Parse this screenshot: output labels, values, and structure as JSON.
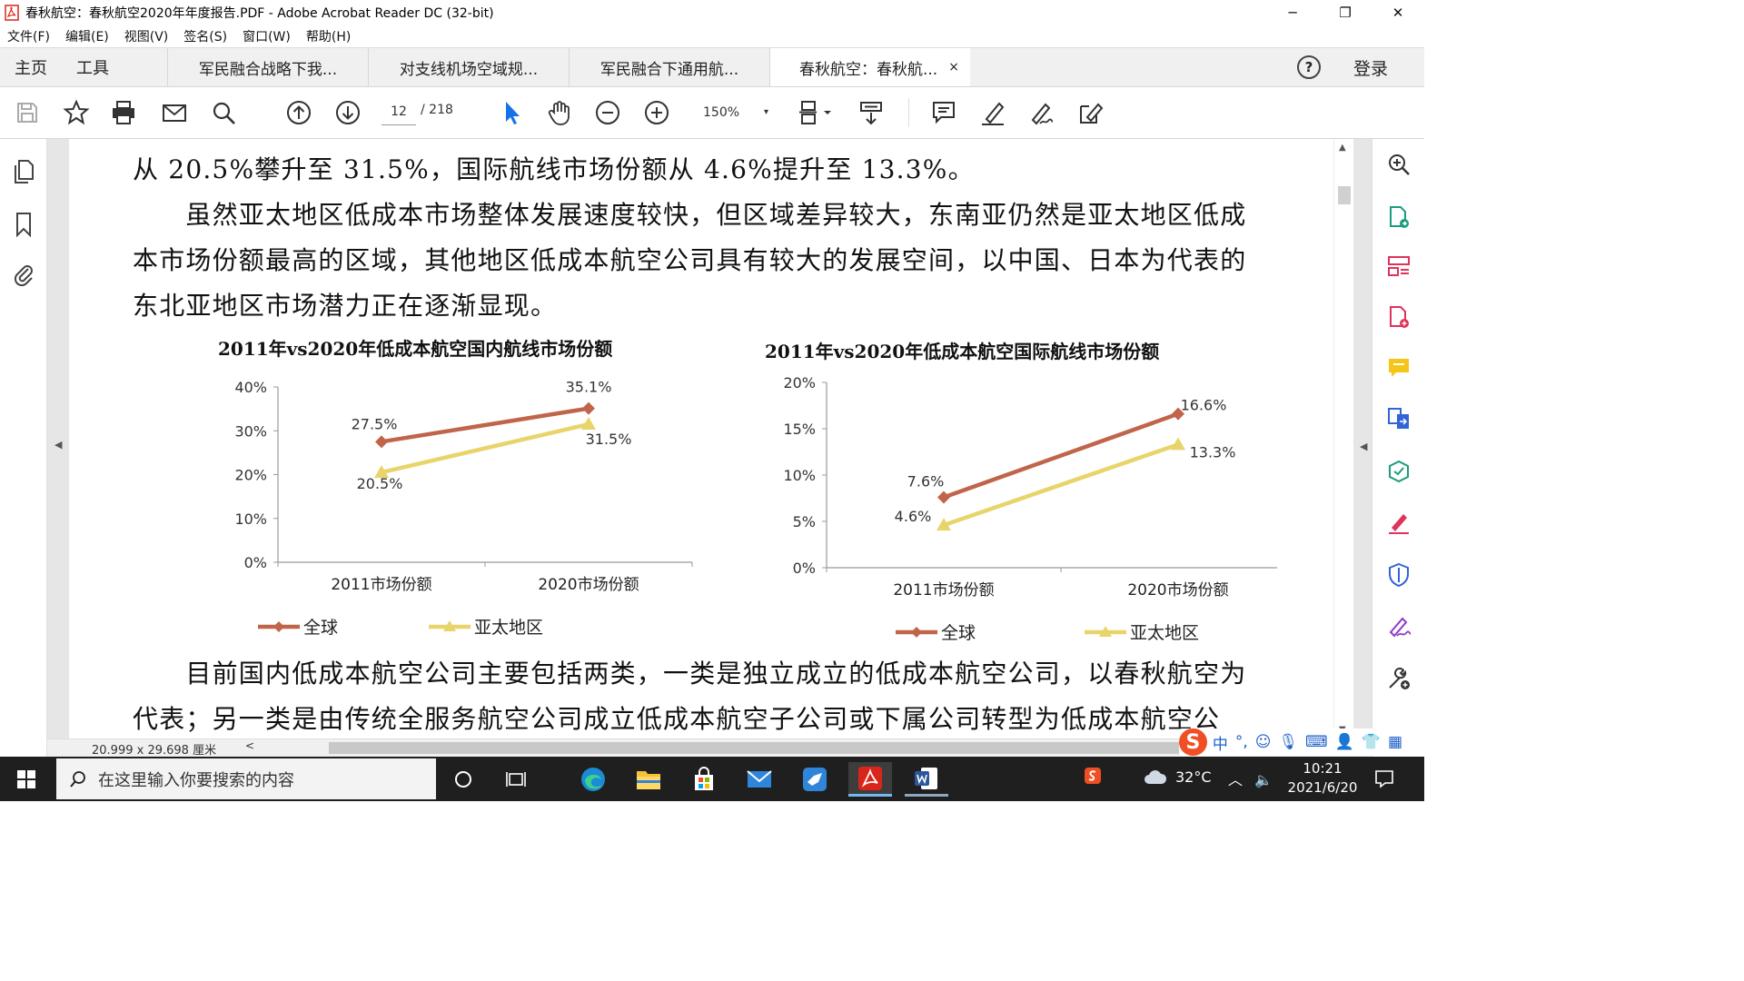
{
  "window": {
    "title": "春秋航空：春秋航空2020年年度报告.PDF - Adobe Acrobat Reader DC (32-bit)"
  },
  "menu": [
    "文件(F)",
    "编辑(E)",
    "视图(V)",
    "签名(S)",
    "窗口(W)",
    "帮助(H)"
  ],
  "tabs": {
    "home": "主页",
    "tools": "工具",
    "docs": [
      "军民融合战略下我...",
      "对支线机场空域规...",
      "军民融合下通用航...",
      "春秋航空：春秋航..."
    ],
    "close": "×",
    "login": "登录",
    "help": "?"
  },
  "toolbar": {
    "page_current": "12",
    "page_total": "/ 218",
    "zoom": "150%",
    "zoom_arrow": "▾"
  },
  "document": {
    "paragraphs": [
      "从 20.5%攀升至 31.5%，国际航线市场份额从 4.6%提升至 13.3%。",
      "　　虽然亚太地区低成本市场整体发展速度较快，但区域差异较大，东南亚仍然是亚太地区低成",
      "本市场份额最高的区域，其他地区低成本航空公司具有较大的发展空间，以中国、日本为代表的",
      "东北亚地区市场潜力正在逐渐显现。",
      "　　目前国内低成本航空公司主要包括两类，一类是独立成立的低成本航空公司，以春秋航空为",
      "代表；另一类是由传统全服务航空公司成立低成本航空子公司或下属公司转型为低成本航空公"
    ]
  },
  "chart_data": [
    {
      "type": "line",
      "title": "2011年vs2020年低成本航空国内航线市场份额",
      "categories": [
        "2011市场份额",
        "2020市场份额"
      ],
      "series": [
        {
          "name": "全球",
          "values": [
            27.5,
            35.1
          ],
          "labels": [
            "27.5%",
            "35.1%"
          ],
          "color": "#c0654a"
        },
        {
          "name": "亚太地区",
          "values": [
            20.5,
            31.5
          ],
          "labels": [
            "20.5%",
            "31.5%"
          ],
          "color": "#e8d46a"
        }
      ],
      "yticks": [
        "0%",
        "10%",
        "20%",
        "30%",
        "40%"
      ],
      "ylim": [
        0,
        40
      ],
      "legend": "bottom"
    },
    {
      "type": "line",
      "title": "2011年vs2020年低成本航空国际航线市场份额",
      "categories": [
        "2011市场份额",
        "2020市场份额"
      ],
      "series": [
        {
          "name": "全球",
          "values": [
            7.6,
            16.6
          ],
          "labels": [
            "7.6%",
            "16.6%"
          ],
          "color": "#c0654a"
        },
        {
          "name": "亚太地区",
          "values": [
            4.6,
            13.3
          ],
          "labels": [
            "4.6%",
            "13.3%"
          ],
          "color": "#e8d46a"
        }
      ],
      "yticks": [
        "0%",
        "5%",
        "10%",
        "15%",
        "20%"
      ],
      "ylim": [
        0,
        20
      ],
      "legend": "bottom"
    }
  ],
  "status": {
    "page_size": "20.999 x 29.698 厘米",
    "scroll_left": "<"
  },
  "ime": {
    "logo": "S",
    "mode": "中",
    "punct": "°,"
  },
  "taskbar": {
    "search_placeholder": "在这里输入你要搜索的内容",
    "temperature": "32°C",
    "time": "10:21",
    "date": "2021/6/20"
  },
  "icons": {
    "app": "acrobat-icon",
    "colors": {
      "acrobat_red": "#d9261c",
      "accent_blue": "#1473e6",
      "green": "#1a9c7d"
    }
  }
}
